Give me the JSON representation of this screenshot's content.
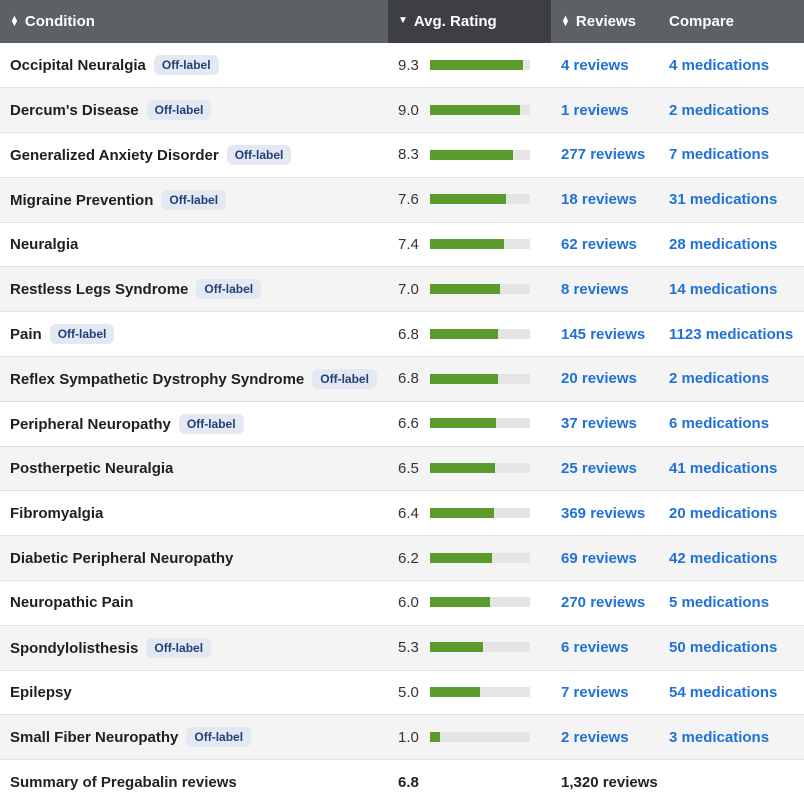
{
  "columns": {
    "condition": "Condition",
    "rating": "Avg. Rating",
    "reviews": "Reviews",
    "compare": "Compare"
  },
  "colors": {
    "header_bg": "#5d6064",
    "header_sorted_bg": "#3d3f42",
    "bar_fill": "#5b9b2c",
    "link": "#1f71d6",
    "badge_bg": "#e3e8f3"
  },
  "rows": [
    {
      "condition": "Occipital Neuralgia",
      "badge": "Off-label",
      "rating": "9.3",
      "rating_value": 9.3,
      "reviews": "4 reviews",
      "compare": "4 medications"
    },
    {
      "condition": "Dercum's Disease",
      "badge": "Off-label",
      "rating": "9.0",
      "rating_value": 9.0,
      "reviews": "1 reviews",
      "compare": "2 medications"
    },
    {
      "condition": "Generalized Anxiety Disorder",
      "badge": "Off-label",
      "rating": "8.3",
      "rating_value": 8.3,
      "reviews": "277 reviews",
      "compare": "7 medications"
    },
    {
      "condition": "Migraine Prevention",
      "badge": "Off-label",
      "rating": "7.6",
      "rating_value": 7.6,
      "reviews": "18 reviews",
      "compare": "31 medications"
    },
    {
      "condition": "Neuralgia",
      "badge": "",
      "rating": "7.4",
      "rating_value": 7.4,
      "reviews": "62 reviews",
      "compare": "28 medications"
    },
    {
      "condition": "Restless Legs Syndrome",
      "badge": "Off-label",
      "rating": "7.0",
      "rating_value": 7.0,
      "reviews": "8 reviews",
      "compare": "14 medications"
    },
    {
      "condition": "Pain",
      "badge": "Off-label",
      "rating": "6.8",
      "rating_value": 6.8,
      "reviews": "145 reviews",
      "compare": "1123 medications"
    },
    {
      "condition": "Reflex Sympathetic Dystrophy Syndrome",
      "badge": "Off-label",
      "rating": "6.8",
      "rating_value": 6.8,
      "reviews": "20 reviews",
      "compare": "2 medications"
    },
    {
      "condition": "Peripheral Neuropathy",
      "badge": "Off-label",
      "rating": "6.6",
      "rating_value": 6.6,
      "reviews": "37 reviews",
      "compare": "6 medications"
    },
    {
      "condition": "Postherpetic Neuralgia",
      "badge": "",
      "rating": "6.5",
      "rating_value": 6.5,
      "reviews": "25 reviews",
      "compare": "41 medications"
    },
    {
      "condition": "Fibromyalgia",
      "badge": "",
      "rating": "6.4",
      "rating_value": 6.4,
      "reviews": "369 reviews",
      "compare": "20 medications"
    },
    {
      "condition": "Diabetic Peripheral Neuropathy",
      "badge": "",
      "rating": "6.2",
      "rating_value": 6.2,
      "reviews": "69 reviews",
      "compare": "42 medications"
    },
    {
      "condition": "Neuropathic Pain",
      "badge": "",
      "rating": "6.0",
      "rating_value": 6.0,
      "reviews": "270 reviews",
      "compare": "5 medications"
    },
    {
      "condition": "Spondylolisthesis",
      "badge": "Off-label",
      "rating": "5.3",
      "rating_value": 5.3,
      "reviews": "6 reviews",
      "compare": "50 medications"
    },
    {
      "condition": "Epilepsy",
      "badge": "",
      "rating": "5.0",
      "rating_value": 5.0,
      "reviews": "7 reviews",
      "compare": "54 medications"
    },
    {
      "condition": "Small Fiber Neuropathy",
      "badge": "Off-label",
      "rating": "1.0",
      "rating_value": 1.0,
      "reviews": "2 reviews",
      "compare": "3 medications"
    }
  ],
  "summary": {
    "label": "Summary of Pregabalin reviews",
    "rating": "6.8",
    "reviews": "1,320 reviews"
  }
}
